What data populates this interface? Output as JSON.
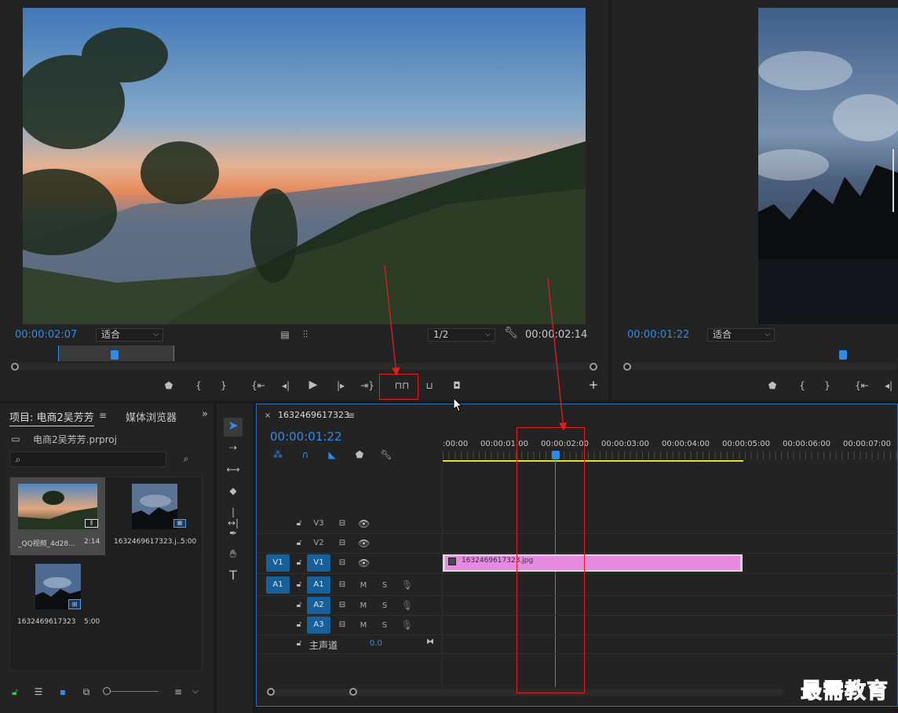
{
  "source_monitor": {
    "timecode_in": "00:00:02:07",
    "fit": "适合",
    "resolution": "1/2",
    "timecode_duration": "00:00:02:14"
  },
  "program_monitor": {
    "timecode": "00:00:01:22",
    "fit": "适合"
  },
  "project": {
    "tab_project": "项目: 电商2吴芳芳",
    "tab_media": "媒体浏览器",
    "file_name": "电商2吴芳芳.prproj",
    "search_placeholder": "",
    "items": [
      {
        "name": "_QQ视频_4d28...",
        "duration": "2:14"
      },
      {
        "name": "1632469617323.j...",
        "duration": "5:00"
      },
      {
        "name": "1632469617323",
        "duration": "5:00"
      }
    ]
  },
  "timeline": {
    "sequence_name": "1632469617323",
    "timecode": "00:00:01:22",
    "ruler": [
      ":00:00",
      "00:00:01:00",
      "00:00:02:00",
      "00:00:03:00",
      "00:00:04:00",
      "00:00:05:00",
      "00:00:06:00",
      "00:00:07:00"
    ],
    "tracks": {
      "v3": "V3",
      "v2": "V2",
      "v1": "V1",
      "v1_src": "V1",
      "a1": "A1",
      "a1_src": "A1",
      "a2": "A2",
      "a3": "A3",
      "mute": "M",
      "solo": "S",
      "master": "主声道",
      "master_value": "0.0"
    },
    "clip_name": "1632469617323.jpg"
  },
  "watermark": "最需教育",
  "colors": {
    "accent": "#2d8ceb",
    "clip": "#e58ae0",
    "annotation": "#e01e1e",
    "target": "#17609a",
    "work_area": "#e3e31a"
  }
}
